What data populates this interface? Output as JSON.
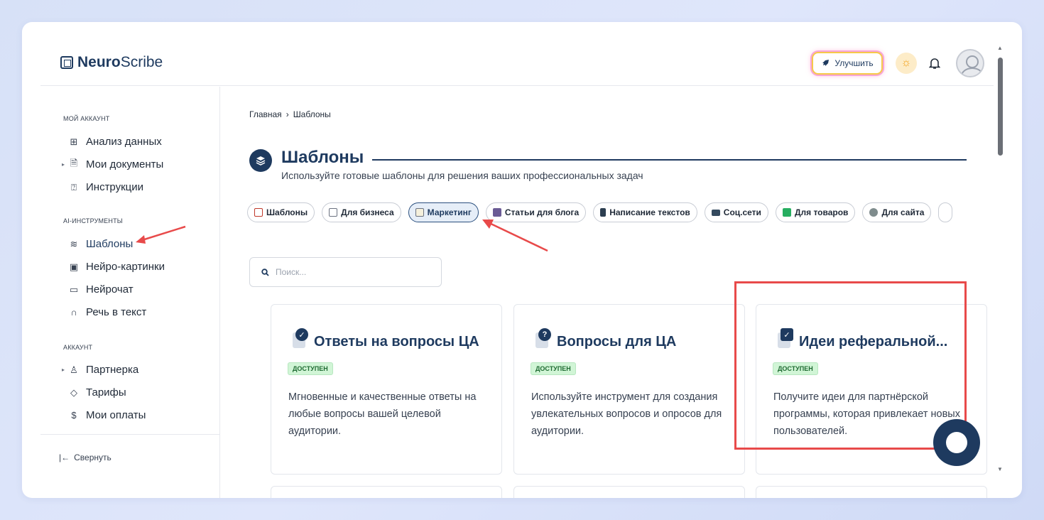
{
  "app": {
    "brand_bold": "Neuro",
    "brand_light": "Scribe"
  },
  "header": {
    "upgrade_label": "Улучшить"
  },
  "sidebar": {
    "section_account": "МОЙ АККАУНТ",
    "items_account": [
      "Анализ данных",
      "Мои документы",
      "Инструкции"
    ],
    "section_ai": "AI-ИНСТРУМЕНТЫ",
    "items_ai": [
      "Шаблоны",
      "Нейро-картинки",
      "Нейрочат",
      "Речь в текст"
    ],
    "section_acc2": "АККАУНТ",
    "items_acc2": [
      "Партнерка",
      "Тарифы",
      "Мои оплаты"
    ],
    "collapse_label": "Свернуть"
  },
  "breadcrumb": {
    "home": "Главная",
    "sep": "›",
    "current": "Шаблоны"
  },
  "page": {
    "title": "Шаблоны",
    "subtitle": "Используйте готовые шаблоны для решения ваших профессиональных задач"
  },
  "chips": [
    "Шаблоны",
    "Для бизнеса",
    "Маркетинг",
    "Статьи для блога",
    "Написание текстов",
    "Соц.сети",
    "Для товаров",
    "Для сайта"
  ],
  "active_chip": "Маркетинг",
  "search": {
    "placeholder": "Поиск..."
  },
  "cards": [
    {
      "title": "Ответы на вопросы ЦА",
      "badge": "ДОСТУПЕН",
      "desc": "Мгновенные и качественные ответы на любые вопросы вашей целевой аудитории."
    },
    {
      "title": "Вопросы для ЦА",
      "badge": "ДОСТУПЕН",
      "desc": "Используйте инструмент для создания увлекательных вопросов и опросов для аудитории."
    },
    {
      "title": "Идеи реферальной...",
      "badge": "ДОСТУПЕН",
      "desc": "Получите идеи для партнёрской программы, которая привлекает новых пользователей."
    }
  ],
  "colors": {
    "brand": "#1e3a5f",
    "highlight": "#e84a4a",
    "badge_bg": "#d1f5d6"
  }
}
